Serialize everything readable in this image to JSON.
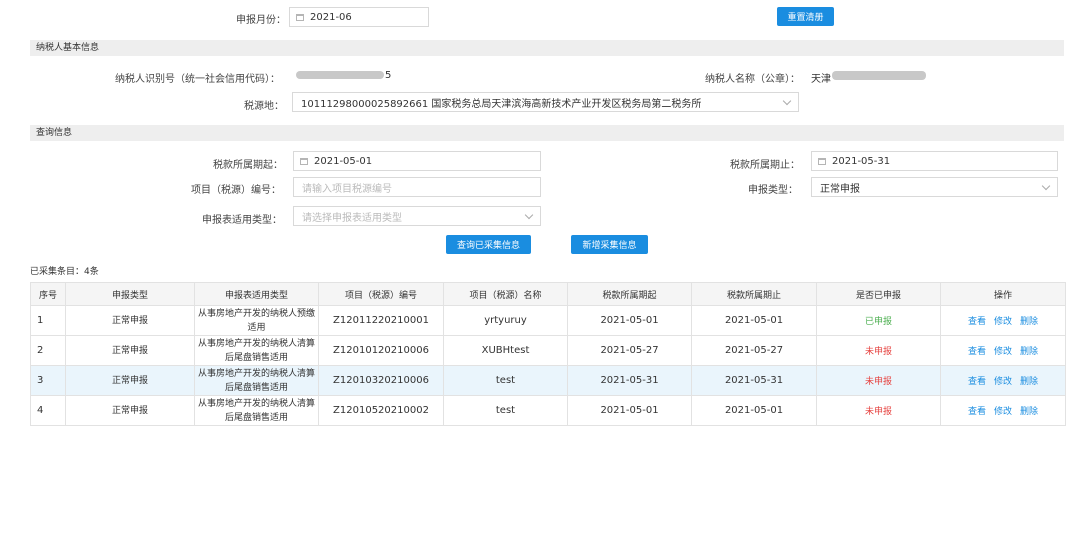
{
  "top": {
    "month_label": "申报月份：",
    "month_value": "2021-06",
    "reset_button": "重置清册"
  },
  "basic_section": {
    "title": "纳税人基本信息",
    "taxpayer_id_label": "纳税人识别号（统一社会信用代码）：",
    "taxpayer_id_suffix": "5",
    "taxpayer_name_label": "纳税人名称（公章）：",
    "taxpayer_name_prefix": "天津",
    "tax_source_label": "税源地：",
    "tax_source_value": "10111298000025892661 国家税务总局天津滨海高新技术产业开发区税务局第二税务所"
  },
  "query_section": {
    "title": "查询信息",
    "period_start_label": "税款所属期起：",
    "period_start_value": "2021-05-01",
    "period_end_label": "税款所属期止：",
    "period_end_value": "2021-05-31",
    "project_no_label": "项目（税源）编号：",
    "project_no_placeholder": "请输入项目税源编号",
    "declare_type_label": "申报类型：",
    "declare_type_value": "正常申报",
    "form_type_label": "申报表适用类型：",
    "form_type_placeholder": "请选择申报表适用类型",
    "query_button": "查询已采集信息",
    "add_button": "新增采集信息"
  },
  "summary": {
    "count_text": "已采集条目：4条"
  },
  "table": {
    "headers": [
      "序号",
      "申报类型",
      "申报表适用类型",
      "项目（税源）编号",
      "项目（税源）名称",
      "税款所属期起",
      "税款所属期止",
      "是否已申报",
      "操作"
    ],
    "actions": {
      "view": "查看",
      "edit": "修改",
      "delete": "删除"
    },
    "rows": [
      {
        "no": "1",
        "type": "正常申报",
        "form": "从事房地产开发的纳税人预缴适用",
        "code": "Z12011220210001",
        "name": "yrtyuruy",
        "start": "2021-05-01",
        "end": "2021-05-01",
        "status": "已申报",
        "status_ok": true
      },
      {
        "no": "2",
        "type": "正常申报",
        "form": "从事房地产开发的纳税人清算后尾盘销售适用",
        "code": "Z12010120210006",
        "name": "XUBHtest",
        "start": "2021-05-27",
        "end": "2021-05-27",
        "status": "未申报",
        "status_ok": false
      },
      {
        "no": "3",
        "type": "正常申报",
        "form": "从事房地产开发的纳税人清算后尾盘销售适用",
        "code": "Z12010320210006",
        "name": "test",
        "start": "2021-05-31",
        "end": "2021-05-31",
        "status": "未申报",
        "status_ok": false
      },
      {
        "no": "4",
        "type": "正常申报",
        "form": "从事房地产开发的纳税人清算后尾盘销售适用",
        "code": "Z12010520210002",
        "name": "test",
        "start": "2021-05-01",
        "end": "2021-05-01",
        "status": "未申报",
        "status_ok": false
      }
    ]
  },
  "colors": {
    "primary": "#1a8de0",
    "declared": "#4caf50",
    "undeclared": "#e64340",
    "highlight_row": "#eaf5fc"
  }
}
